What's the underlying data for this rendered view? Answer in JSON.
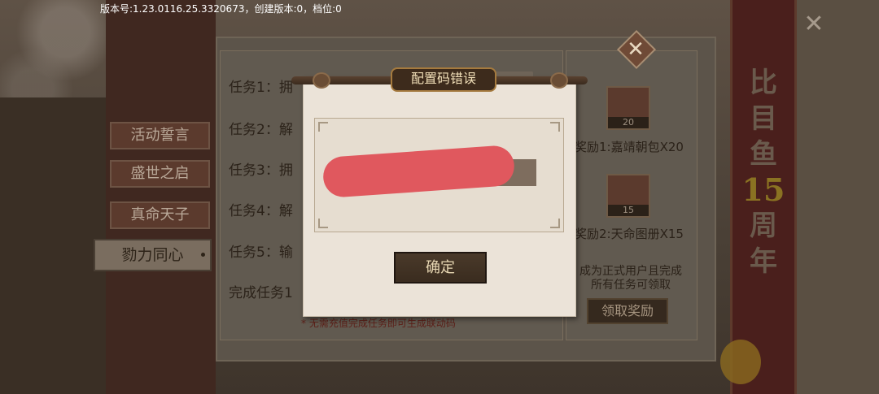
{
  "status": {
    "version_text": "版本号:1.23.0116.25.3320673，创建版本:0，档位:0"
  },
  "sidebar": {
    "tabs": [
      {
        "label": "活动誓言",
        "active": false
      },
      {
        "label": "盛世之启",
        "active": false
      },
      {
        "label": "真命天子",
        "active": false
      },
      {
        "label": "勠力同心",
        "active": true
      }
    ]
  },
  "tasks": {
    "items": [
      {
        "label": "任务1：拥"
      },
      {
        "label": "任务2：解"
      },
      {
        "label": "任务3：拥"
      },
      {
        "label": "任务4：解"
      },
      {
        "label": "任务5：输"
      }
    ],
    "complete_label": "完成任务1",
    "note": "* 无需充值完成任务即可生成联动码"
  },
  "rewards": {
    "items": [
      {
        "label": "奖励1:嘉靖朝包X20",
        "count": "20"
      },
      {
        "label": "奖励2:天命图册X15",
        "count": "15"
      }
    ],
    "claim_hint_line1": "成为正式用户且完成",
    "claim_hint_line2": "所有任务可领取",
    "claim_button": "领取奖励"
  },
  "banner": {
    "chars_top": [
      "比",
      "目",
      "鱼"
    ],
    "number": "15",
    "chars_bottom": [
      "周",
      "年"
    ]
  },
  "dialog": {
    "title": "配置码错误",
    "confirm_label": "确定"
  },
  "colors": {
    "dialog_paper": "#ebe3d8",
    "confirm_button": "#3f3123",
    "redaction": "#e0585e"
  }
}
